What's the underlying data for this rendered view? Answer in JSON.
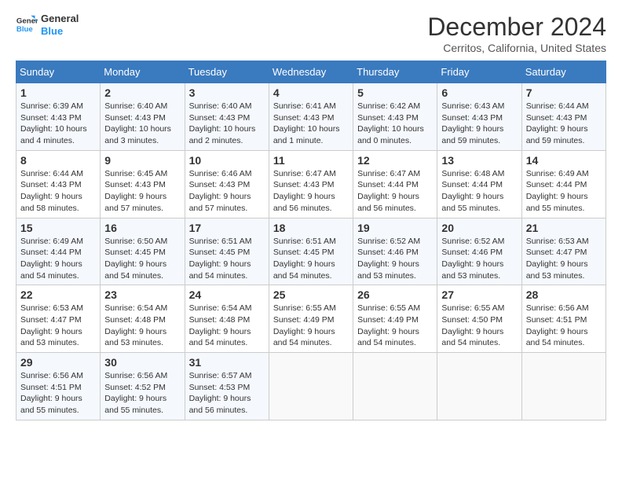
{
  "header": {
    "logo_line1": "General",
    "logo_line2": "Blue",
    "month_title": "December 2024",
    "subtitle": "Cerritos, California, United States"
  },
  "weekdays": [
    "Sunday",
    "Monday",
    "Tuesday",
    "Wednesday",
    "Thursday",
    "Friday",
    "Saturday"
  ],
  "weeks": [
    [
      {
        "day": "1",
        "sunrise": "Sunrise: 6:39 AM",
        "sunset": "Sunset: 4:43 PM",
        "daylight": "Daylight: 10 hours and 4 minutes."
      },
      {
        "day": "2",
        "sunrise": "Sunrise: 6:40 AM",
        "sunset": "Sunset: 4:43 PM",
        "daylight": "Daylight: 10 hours and 3 minutes."
      },
      {
        "day": "3",
        "sunrise": "Sunrise: 6:40 AM",
        "sunset": "Sunset: 4:43 PM",
        "daylight": "Daylight: 10 hours and 2 minutes."
      },
      {
        "day": "4",
        "sunrise": "Sunrise: 6:41 AM",
        "sunset": "Sunset: 4:43 PM",
        "daylight": "Daylight: 10 hours and 1 minute."
      },
      {
        "day": "5",
        "sunrise": "Sunrise: 6:42 AM",
        "sunset": "Sunset: 4:43 PM",
        "daylight": "Daylight: 10 hours and 0 minutes."
      },
      {
        "day": "6",
        "sunrise": "Sunrise: 6:43 AM",
        "sunset": "Sunset: 4:43 PM",
        "daylight": "Daylight: 9 hours and 59 minutes."
      },
      {
        "day": "7",
        "sunrise": "Sunrise: 6:44 AM",
        "sunset": "Sunset: 4:43 PM",
        "daylight": "Daylight: 9 hours and 59 minutes."
      }
    ],
    [
      {
        "day": "8",
        "sunrise": "Sunrise: 6:44 AM",
        "sunset": "Sunset: 4:43 PM",
        "daylight": "Daylight: 9 hours and 58 minutes."
      },
      {
        "day": "9",
        "sunrise": "Sunrise: 6:45 AM",
        "sunset": "Sunset: 4:43 PM",
        "daylight": "Daylight: 9 hours and 57 minutes."
      },
      {
        "day": "10",
        "sunrise": "Sunrise: 6:46 AM",
        "sunset": "Sunset: 4:43 PM",
        "daylight": "Daylight: 9 hours and 57 minutes."
      },
      {
        "day": "11",
        "sunrise": "Sunrise: 6:47 AM",
        "sunset": "Sunset: 4:43 PM",
        "daylight": "Daylight: 9 hours and 56 minutes."
      },
      {
        "day": "12",
        "sunrise": "Sunrise: 6:47 AM",
        "sunset": "Sunset: 4:44 PM",
        "daylight": "Daylight: 9 hours and 56 minutes."
      },
      {
        "day": "13",
        "sunrise": "Sunrise: 6:48 AM",
        "sunset": "Sunset: 4:44 PM",
        "daylight": "Daylight: 9 hours and 55 minutes."
      },
      {
        "day": "14",
        "sunrise": "Sunrise: 6:49 AM",
        "sunset": "Sunset: 4:44 PM",
        "daylight": "Daylight: 9 hours and 55 minutes."
      }
    ],
    [
      {
        "day": "15",
        "sunrise": "Sunrise: 6:49 AM",
        "sunset": "Sunset: 4:44 PM",
        "daylight": "Daylight: 9 hours and 54 minutes."
      },
      {
        "day": "16",
        "sunrise": "Sunrise: 6:50 AM",
        "sunset": "Sunset: 4:45 PM",
        "daylight": "Daylight: 9 hours and 54 minutes."
      },
      {
        "day": "17",
        "sunrise": "Sunrise: 6:51 AM",
        "sunset": "Sunset: 4:45 PM",
        "daylight": "Daylight: 9 hours and 54 minutes."
      },
      {
        "day": "18",
        "sunrise": "Sunrise: 6:51 AM",
        "sunset": "Sunset: 4:45 PM",
        "daylight": "Daylight: 9 hours and 54 minutes."
      },
      {
        "day": "19",
        "sunrise": "Sunrise: 6:52 AM",
        "sunset": "Sunset: 4:46 PM",
        "daylight": "Daylight: 9 hours and 53 minutes."
      },
      {
        "day": "20",
        "sunrise": "Sunrise: 6:52 AM",
        "sunset": "Sunset: 4:46 PM",
        "daylight": "Daylight: 9 hours and 53 minutes."
      },
      {
        "day": "21",
        "sunrise": "Sunrise: 6:53 AM",
        "sunset": "Sunset: 4:47 PM",
        "daylight": "Daylight: 9 hours and 53 minutes."
      }
    ],
    [
      {
        "day": "22",
        "sunrise": "Sunrise: 6:53 AM",
        "sunset": "Sunset: 4:47 PM",
        "daylight": "Daylight: 9 hours and 53 minutes."
      },
      {
        "day": "23",
        "sunrise": "Sunrise: 6:54 AM",
        "sunset": "Sunset: 4:48 PM",
        "daylight": "Daylight: 9 hours and 53 minutes."
      },
      {
        "day": "24",
        "sunrise": "Sunrise: 6:54 AM",
        "sunset": "Sunset: 4:48 PM",
        "daylight": "Daylight: 9 hours and 54 minutes."
      },
      {
        "day": "25",
        "sunrise": "Sunrise: 6:55 AM",
        "sunset": "Sunset: 4:49 PM",
        "daylight": "Daylight: 9 hours and 54 minutes."
      },
      {
        "day": "26",
        "sunrise": "Sunrise: 6:55 AM",
        "sunset": "Sunset: 4:49 PM",
        "daylight": "Daylight: 9 hours and 54 minutes."
      },
      {
        "day": "27",
        "sunrise": "Sunrise: 6:55 AM",
        "sunset": "Sunset: 4:50 PM",
        "daylight": "Daylight: 9 hours and 54 minutes."
      },
      {
        "day": "28",
        "sunrise": "Sunrise: 6:56 AM",
        "sunset": "Sunset: 4:51 PM",
        "daylight": "Daylight: 9 hours and 54 minutes."
      }
    ],
    [
      {
        "day": "29",
        "sunrise": "Sunrise: 6:56 AM",
        "sunset": "Sunset: 4:51 PM",
        "daylight": "Daylight: 9 hours and 55 minutes."
      },
      {
        "day": "30",
        "sunrise": "Sunrise: 6:56 AM",
        "sunset": "Sunset: 4:52 PM",
        "daylight": "Daylight: 9 hours and 55 minutes."
      },
      {
        "day": "31",
        "sunrise": "Sunrise: 6:57 AM",
        "sunset": "Sunset: 4:53 PM",
        "daylight": "Daylight: 9 hours and 56 minutes."
      },
      null,
      null,
      null,
      null
    ]
  ]
}
